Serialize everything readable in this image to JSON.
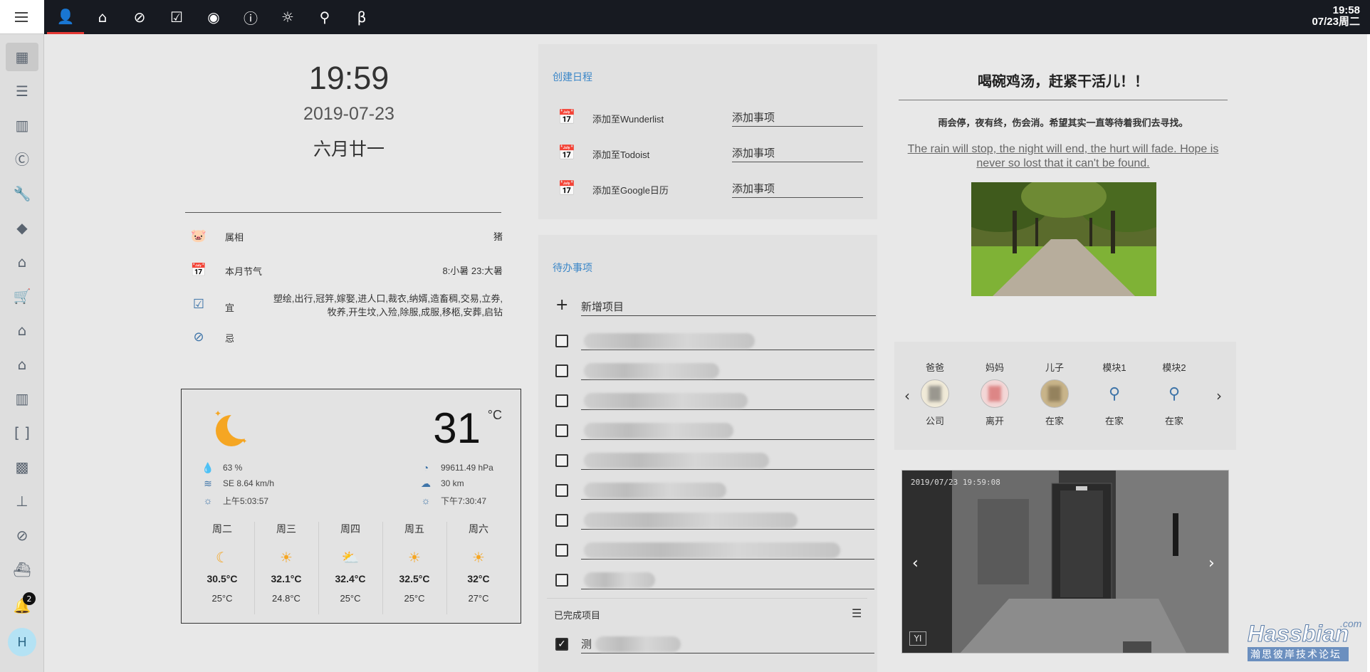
{
  "sidebar": {
    "menu_icon": "menu-icon",
    "items": [
      {
        "name": "sidebar-item-apps",
        "glyph": "▦",
        "active": true
      },
      {
        "name": "sidebar-item-list",
        "glyph": "☰"
      },
      {
        "name": "sidebar-item-chart",
        "glyph": "▥"
      },
      {
        "name": "sidebar-item-c",
        "glyph": "Ⓒ"
      },
      {
        "name": "sidebar-item-wrench",
        "glyph": "🔧"
      },
      {
        "name": "sidebar-item-directions",
        "glyph": "◆"
      },
      {
        "name": "sidebar-item-home-assistant",
        "glyph": "⌂"
      },
      {
        "name": "sidebar-item-cart",
        "glyph": "🛒"
      },
      {
        "name": "sidebar-item-home-settings",
        "glyph": "⌂"
      },
      {
        "name": "sidebar-item-home",
        "glyph": "⌂"
      },
      {
        "name": "sidebar-item-fence",
        "glyph": "▥"
      },
      {
        "name": "sidebar-item-brackets",
        "glyph": "[ ]"
      },
      {
        "name": "sidebar-item-chip",
        "glyph": "▩"
      },
      {
        "name": "sidebar-item-sitemap",
        "glyph": "⊥"
      },
      {
        "name": "sidebar-item-block",
        "glyph": "⊘"
      },
      {
        "name": "sidebar-item-ship",
        "glyph": "⛴"
      }
    ],
    "notification_count": "2",
    "user_initial": "H"
  },
  "topbar": {
    "tabs": [
      {
        "name": "tab-person",
        "glyph": "👤",
        "active": true
      },
      {
        "name": "tab-home",
        "glyph": "⌂"
      },
      {
        "name": "tab-compass",
        "glyph": "⊘"
      },
      {
        "name": "tab-calendar-check",
        "glyph": "☑"
      },
      {
        "name": "tab-webcam",
        "glyph": "◉"
      },
      {
        "name": "tab-info",
        "glyph": "ⓘ"
      },
      {
        "name": "tab-brightness",
        "glyph": "☼"
      },
      {
        "name": "tab-map-marker",
        "glyph": "⚲"
      },
      {
        "name": "tab-beta",
        "glyph": "β"
      }
    ],
    "time": "19:58",
    "date": "07/23周二"
  },
  "clock": {
    "time": "19:59",
    "date": "2019-07-23",
    "lunar": "六月廿一"
  },
  "almanac": [
    {
      "icon": "pig-icon",
      "label": "属相",
      "value": "猪"
    },
    {
      "icon": "calendar-icon",
      "label": "本月节气",
      "value": "8:小暑 23:大暑"
    },
    {
      "icon": "checkbox-icon",
      "label": "宜",
      "value": "塑绘,出行,冠笄,嫁娶,进人口,裁衣,纳婿,造畜稠,交易,立券,牧养,开生坟,入殓,除服,成服,移柩,安葬,启钻"
    },
    {
      "icon": "cancel-icon",
      "label": "忌",
      "value": ""
    }
  ],
  "weather": {
    "temperature": "31",
    "unit": "°C",
    "humidity": "63 %",
    "wind": "SE 8.64 km/h",
    "sunrise": "上午5:03:57",
    "pressure": "99611.49 hPa",
    "visibility": "30 km",
    "sunset": "下午7:30:47",
    "forecast": [
      {
        "day": "周二",
        "icon": "night-moon-icon",
        "glyph": "☾",
        "high": "30.5°C",
        "low": "25°C"
      },
      {
        "day": "周三",
        "icon": "sunny-icon",
        "glyph": "☀",
        "high": "32.1°C",
        "low": "24.8°C"
      },
      {
        "day": "周四",
        "icon": "partly-cloudy-icon",
        "glyph": "⛅",
        "high": "32.4°C",
        "low": "25°C"
      },
      {
        "day": "周五",
        "icon": "sunny-icon",
        "glyph": "☀",
        "high": "32.5°C",
        "low": "25°C"
      },
      {
        "day": "周六",
        "icon": "sunny-icon",
        "glyph": "☀",
        "high": "32°C",
        "low": "27°C"
      }
    ]
  },
  "schedule": {
    "title": "创建日程",
    "rows": [
      {
        "label": "添加至Wunderlist",
        "placeholder": "添加事项"
      },
      {
        "label": "添加至Todoist",
        "placeholder": "添加事项"
      },
      {
        "label": "添加至Google日历",
        "placeholder": "添加事项"
      }
    ]
  },
  "todo": {
    "title": "待办事项",
    "add_label": "新增项目",
    "completed_title": "已完成项目",
    "completed_item": "测"
  },
  "quote": {
    "title": "喝碗鸡汤，赶紧干活儿！！",
    "chinese": "雨会停，夜有终，伤会消。希望其实一直等待着我们去寻找。",
    "english": "The rain will stop, the night will end, the hurt will fade. Hope is never so lost that it can't be found."
  },
  "persons": [
    {
      "name": "爸爸",
      "state": "公司",
      "kind": "photo"
    },
    {
      "name": "妈妈",
      "state": "离开",
      "kind": "photo"
    },
    {
      "name": "儿子",
      "state": "在家",
      "kind": "photo"
    },
    {
      "name": "模块1",
      "state": "在家",
      "kind": "marker"
    },
    {
      "name": "模块2",
      "state": "在家",
      "kind": "marker"
    }
  ],
  "camera": {
    "timestamp": "2019/07/23 19:59:08",
    "logo": "YI"
  },
  "watermark": {
    "brand": "Hassbian",
    "domain": ".com",
    "slogan": "瀚思彼岸技术论坛"
  },
  "colors": {
    "topbar_bg": "#171a21",
    "accent_blue": "#3e74a8",
    "active_tab_underline": "#e53935",
    "weather_sun": "#f5a623"
  }
}
